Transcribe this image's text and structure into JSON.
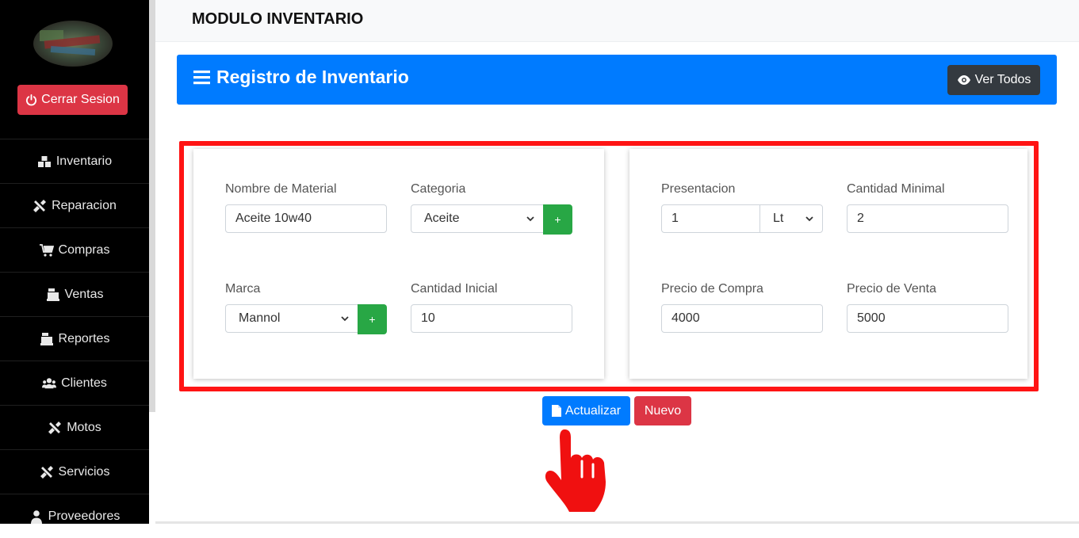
{
  "sidebar": {
    "logout_label": "Cerrar Sesion",
    "items": [
      {
        "label": "Inventario",
        "icon": "boxes-icon"
      },
      {
        "label": "Reparacion",
        "icon": "tools-icon"
      },
      {
        "label": "Compras",
        "icon": "cart-icon"
      },
      {
        "label": "Ventas",
        "icon": "cash-register-icon"
      },
      {
        "label": "Reportes",
        "icon": "cash-register-icon"
      },
      {
        "label": "Clientes",
        "icon": "users-icon"
      },
      {
        "label": "Motos",
        "icon": "tools-icon"
      },
      {
        "label": "Servicios",
        "icon": "tools-icon"
      },
      {
        "label": "Proveedores",
        "icon": "user-tie-icon"
      }
    ]
  },
  "header": {
    "title": "MODULO INVENTARIO"
  },
  "banner": {
    "title": "Registro de Inventario",
    "ver_todos_label": "Ver Todos"
  },
  "form": {
    "nombre_material": {
      "label": "Nombre de Material",
      "value": "Aceite 10w40"
    },
    "categoria": {
      "label": "Categoria",
      "value": "Aceite",
      "add_label": "+"
    },
    "marca": {
      "label": "Marca",
      "value": "Mannol",
      "add_label": "+"
    },
    "cantidad_inicial": {
      "label": "Cantidad Inicial",
      "value": "10"
    },
    "presentacion": {
      "label": "Presentacion",
      "value": "1",
      "unit": "Lt"
    },
    "cantidad_minimal": {
      "label": "Cantidad Minimal",
      "value": "2"
    },
    "precio_compra": {
      "label": "Precio de Compra",
      "value": "4000"
    },
    "precio_venta": {
      "label": "Precio de Venta",
      "value": "5000"
    }
  },
  "actions": {
    "actualizar_label": "Actualizar",
    "nuevo_label": "Nuevo"
  },
  "colors": {
    "primary": "#007bff",
    "danger": "#dc3545",
    "success": "#28a745",
    "dark": "#343a40",
    "highlight": "#ff1414",
    "sidebar": "#000000"
  }
}
